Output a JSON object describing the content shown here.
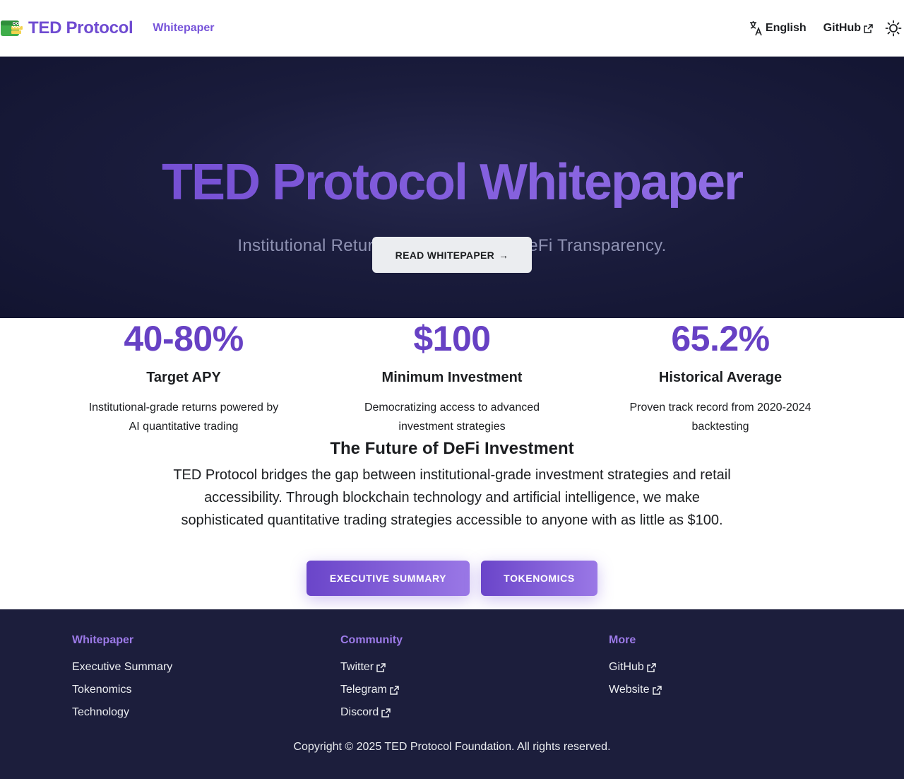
{
  "navbar": {
    "brand_title": "TED Protocol",
    "whitepaper_link": "Whitepaper",
    "language": "English",
    "github": "GitHub"
  },
  "hero": {
    "title": "TED Protocol Whitepaper",
    "subtitle": "Institutional Returns. Retail Access. DeFi Transparency.",
    "button_label": "READ WHITEPAPER",
    "button_arrow": "→"
  },
  "features": [
    {
      "stat": "40-80%",
      "label": "Target APY",
      "desc": "Institutional-grade returns powered by AI quantitative trading"
    },
    {
      "stat": "$100",
      "label": "Minimum Investment",
      "desc": "Democratizing access to advanced investment strategies"
    },
    {
      "stat": "65.2%",
      "label": "Historical Average",
      "desc": "Proven track record from 2020-2024 backtesting"
    }
  ],
  "future": {
    "heading": "The Future of DeFi Investment",
    "body": "TED Protocol bridges the gap between institutional-grade investment strategies and retail accessibility. Through blockchain technology and artificial intelligence, we make sophisticated quantitative trading strategies accessible to anyone with as little as $100.",
    "exec_button": "EXECUTIVE SUMMARY",
    "tokenomics_button": "TOKENOMICS"
  },
  "footer": {
    "columns": [
      {
        "title": "Whitepaper",
        "links": [
          "Executive Summary",
          "Tokenomics",
          "Technology"
        ]
      },
      {
        "title": "Community",
        "links": [
          "Twitter",
          "Telegram",
          "Discord"
        ]
      },
      {
        "title": "More",
        "links": [
          "GitHub",
          "Website"
        ]
      }
    ],
    "copyright": "Copyright © 2025 TED Protocol Foundation. All rights reserved."
  },
  "colors": {
    "accent": "#6f4bd1",
    "hero_bg": "#1a1c3c",
    "footer_bg": "#1c1e3c",
    "footer_heading": "#9c7ae8"
  },
  "icons": {
    "brand": "crocodile-logo-icon",
    "language": "translate-icon",
    "external": "external-link-icon",
    "theme": "sun-icon"
  }
}
